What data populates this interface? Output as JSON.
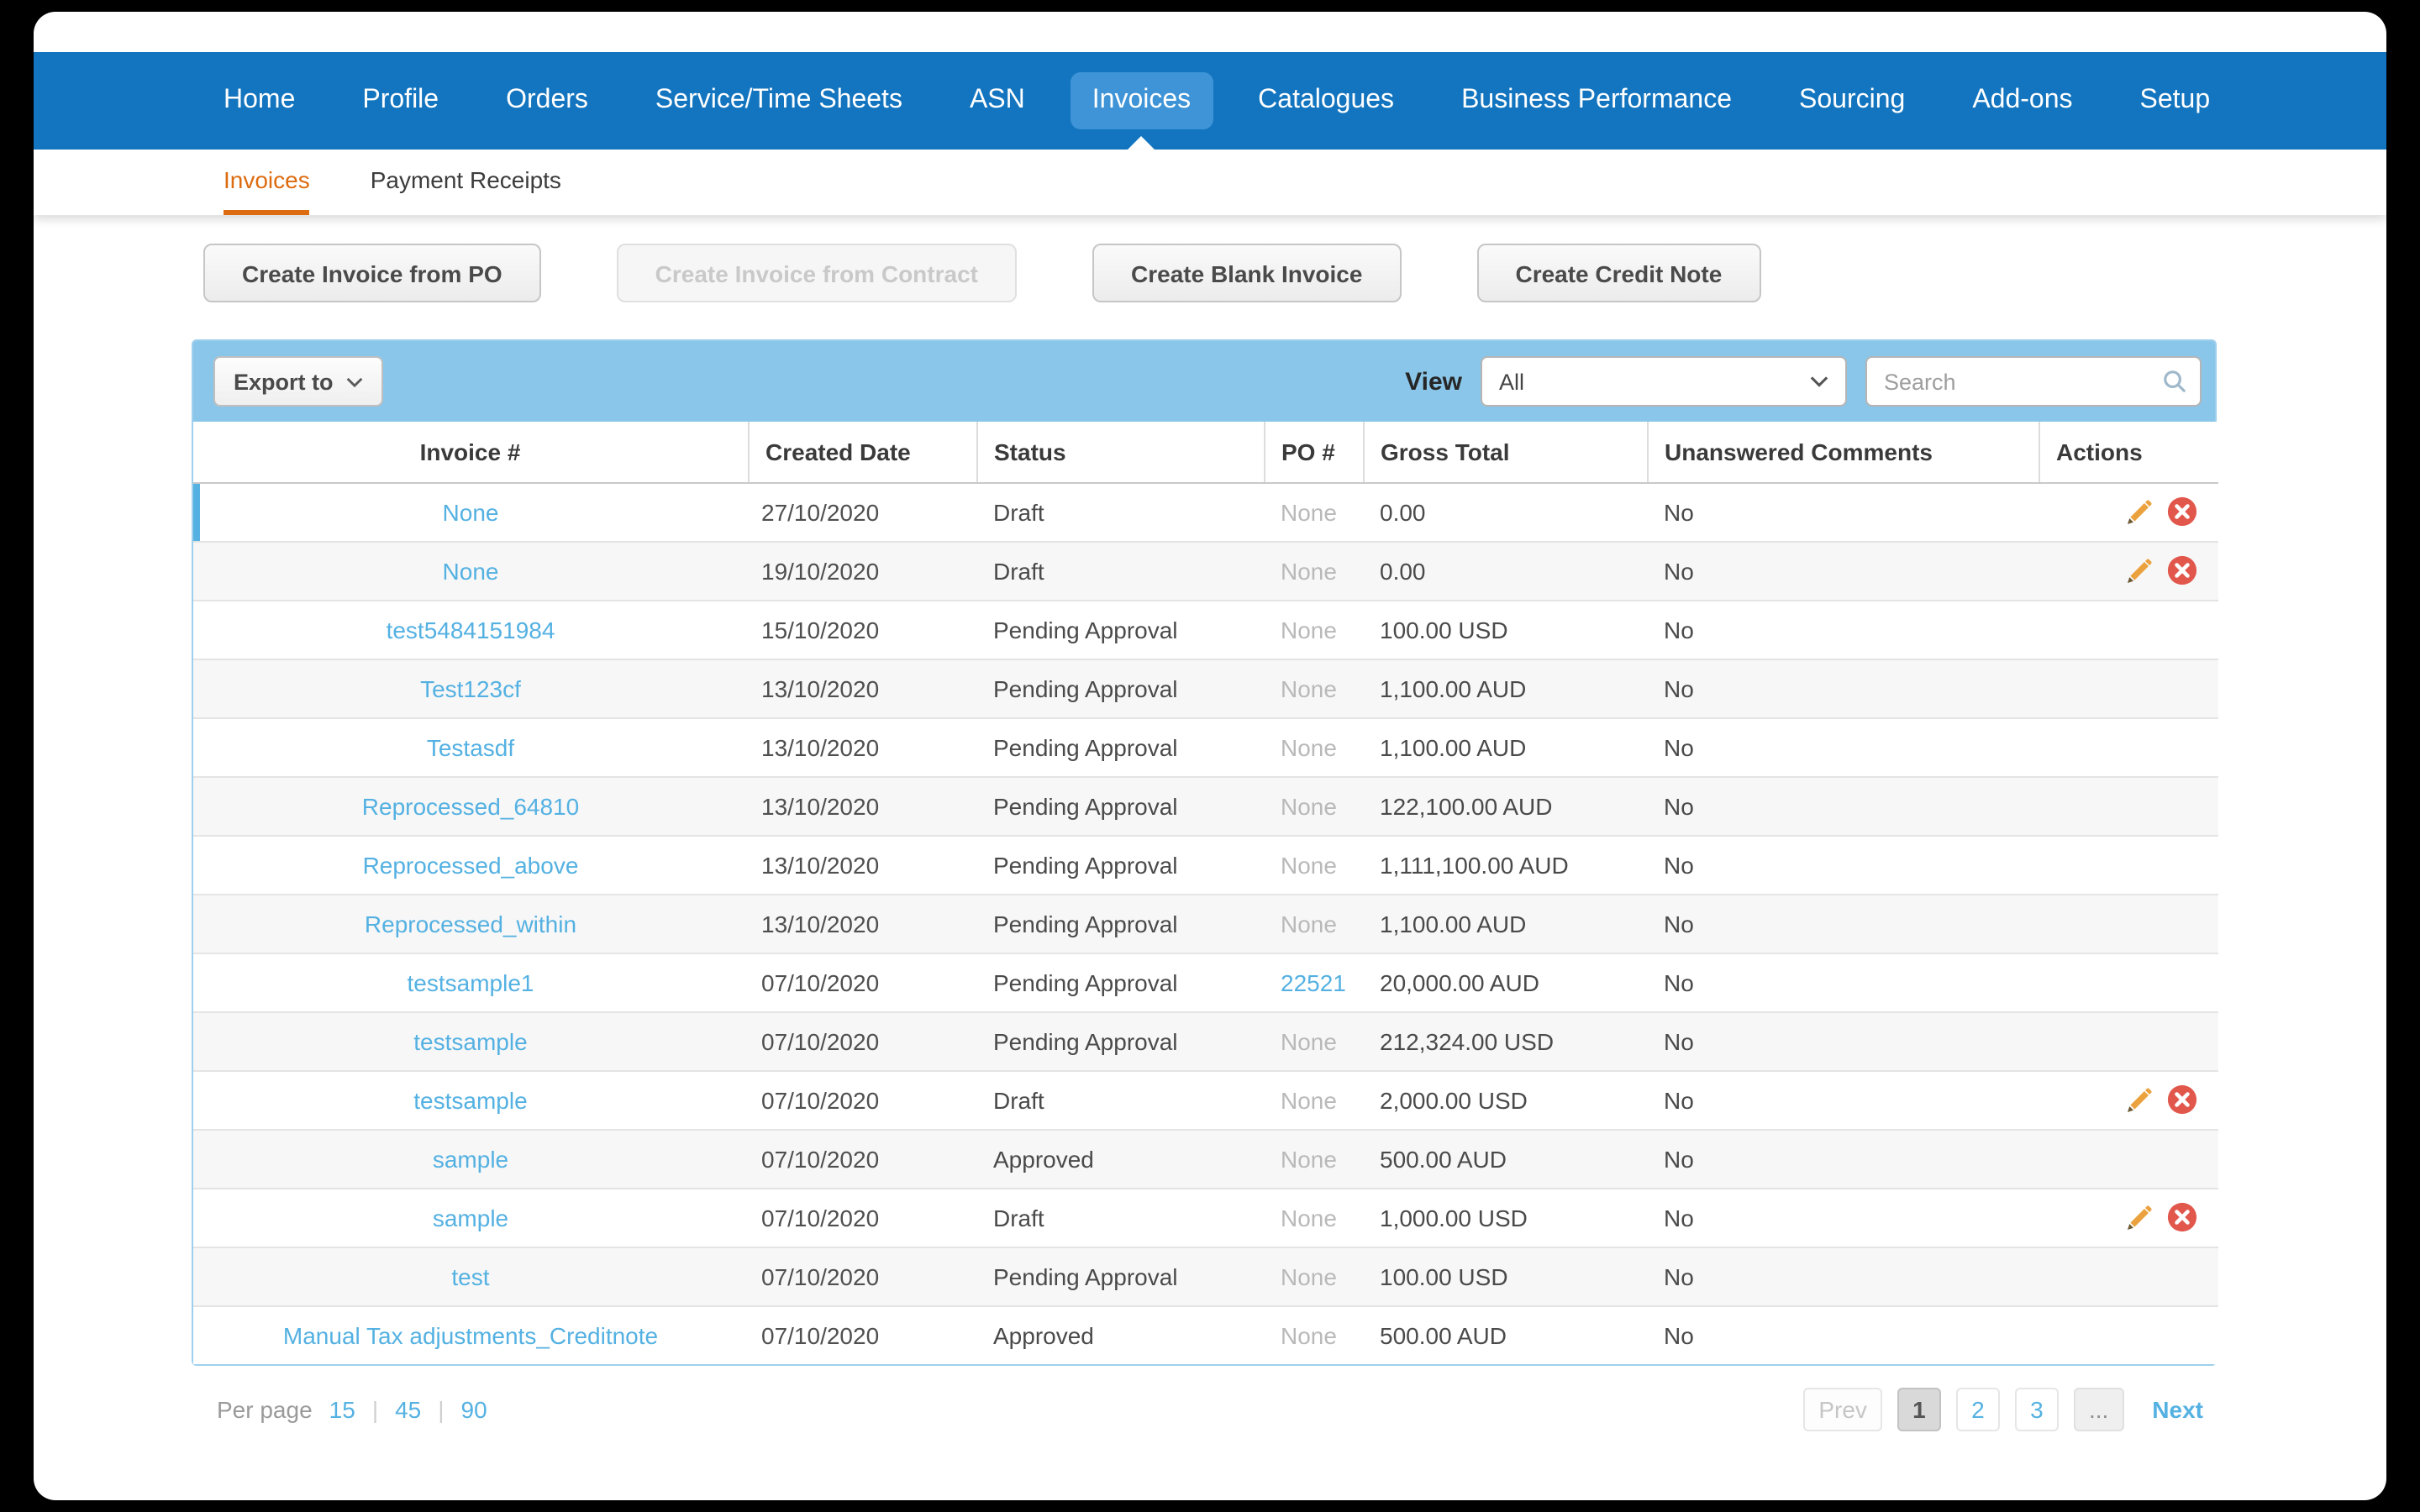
{
  "colors": {
    "nav-blue": "#1375BF",
    "nav-active": "#3E94D6",
    "toolbar-blue": "#8AC6E9",
    "link-blue": "#54B1E2",
    "accent-orange": "#DD6B10",
    "danger-red": "#E2574C",
    "pencil-orange": "#EBA23E"
  },
  "nav": {
    "items": [
      {
        "label": "Home",
        "active": false
      },
      {
        "label": "Profile",
        "active": false
      },
      {
        "label": "Orders",
        "active": false
      },
      {
        "label": "Service/Time Sheets",
        "active": false
      },
      {
        "label": "ASN",
        "active": false
      },
      {
        "label": "Invoices",
        "active": true
      },
      {
        "label": "Catalogues",
        "active": false
      },
      {
        "label": "Business Performance",
        "active": false
      },
      {
        "label": "Sourcing",
        "active": false
      },
      {
        "label": "Add-ons",
        "active": false
      },
      {
        "label": "Setup",
        "active": false
      }
    ]
  },
  "subnav": {
    "items": [
      {
        "label": "Invoices",
        "active": true
      },
      {
        "label": "Payment Receipts",
        "active": false
      }
    ]
  },
  "action_buttons": [
    {
      "label": "Create Invoice from PO",
      "disabled": false
    },
    {
      "label": "Create Invoice from Contract",
      "disabled": true
    },
    {
      "label": "Create Blank Invoice",
      "disabled": false
    },
    {
      "label": "Create Credit Note",
      "disabled": false
    }
  ],
  "toolbar": {
    "export_label": "Export to",
    "view_label": "View",
    "view_value": "All",
    "search_placeholder": "Search"
  },
  "table": {
    "columns": [
      "Invoice #",
      "Created Date",
      "Status",
      "PO #",
      "Gross Total",
      "Unanswered Comments",
      "Actions"
    ],
    "rows": [
      {
        "invoice": "None",
        "created_date": "27/10/2020",
        "status": "Draft",
        "po": "None",
        "po_is_link": false,
        "gross_total": "0.00",
        "unanswered_comments": "No",
        "has_actions": true,
        "selected": true
      },
      {
        "invoice": "None",
        "created_date": "19/10/2020",
        "status": "Draft",
        "po": "None",
        "po_is_link": false,
        "gross_total": "0.00",
        "unanswered_comments": "No",
        "has_actions": true,
        "selected": false
      },
      {
        "invoice": "test5484151984",
        "created_date": "15/10/2020",
        "status": "Pending Approval",
        "po": "None",
        "po_is_link": false,
        "gross_total": "100.00 USD",
        "unanswered_comments": "No",
        "has_actions": false,
        "selected": false
      },
      {
        "invoice": "Test123cf",
        "created_date": "13/10/2020",
        "status": "Pending Approval",
        "po": "None",
        "po_is_link": false,
        "gross_total": "1,100.00 AUD",
        "unanswered_comments": "No",
        "has_actions": false,
        "selected": false
      },
      {
        "invoice": "Testasdf",
        "created_date": "13/10/2020",
        "status": "Pending Approval",
        "po": "None",
        "po_is_link": false,
        "gross_total": "1,100.00 AUD",
        "unanswered_comments": "No",
        "has_actions": false,
        "selected": false
      },
      {
        "invoice": "Reprocessed_64810",
        "created_date": "13/10/2020",
        "status": "Pending Approval",
        "po": "None",
        "po_is_link": false,
        "gross_total": "122,100.00 AUD",
        "unanswered_comments": "No",
        "has_actions": false,
        "selected": false
      },
      {
        "invoice": "Reprocessed_above",
        "created_date": "13/10/2020",
        "status": "Pending Approval",
        "po": "None",
        "po_is_link": false,
        "gross_total": "1,111,100.00 AUD",
        "unanswered_comments": "No",
        "has_actions": false,
        "selected": false
      },
      {
        "invoice": "Reprocessed_within",
        "created_date": "13/10/2020",
        "status": "Pending Approval",
        "po": "None",
        "po_is_link": false,
        "gross_total": "1,100.00 AUD",
        "unanswered_comments": "No",
        "has_actions": false,
        "selected": false
      },
      {
        "invoice": "testsample1",
        "created_date": "07/10/2020",
        "status": "Pending Approval",
        "po": "22521",
        "po_is_link": true,
        "gross_total": "20,000.00 AUD",
        "unanswered_comments": "No",
        "has_actions": false,
        "selected": false
      },
      {
        "invoice": "testsample",
        "created_date": "07/10/2020",
        "status": "Pending Approval",
        "po": "None",
        "po_is_link": false,
        "gross_total": "212,324.00 USD",
        "unanswered_comments": "No",
        "has_actions": false,
        "selected": false
      },
      {
        "invoice": "testsample",
        "created_date": "07/10/2020",
        "status": "Draft",
        "po": "None",
        "po_is_link": false,
        "gross_total": "2,000.00 USD",
        "unanswered_comments": "No",
        "has_actions": true,
        "selected": false
      },
      {
        "invoice": "sample",
        "created_date": "07/10/2020",
        "status": "Approved",
        "po": "None",
        "po_is_link": false,
        "gross_total": "500.00 AUD",
        "unanswered_comments": "No",
        "has_actions": false,
        "selected": false
      },
      {
        "invoice": "sample",
        "created_date": "07/10/2020",
        "status": "Draft",
        "po": "None",
        "po_is_link": false,
        "gross_total": "1,000.00 USD",
        "unanswered_comments": "No",
        "has_actions": true,
        "selected": false
      },
      {
        "invoice": "test",
        "created_date": "07/10/2020",
        "status": "Pending Approval",
        "po": "None",
        "po_is_link": false,
        "gross_total": "100.00 USD",
        "unanswered_comments": "No",
        "has_actions": false,
        "selected": false
      },
      {
        "invoice": "Manual Tax adjustments_Creditnote",
        "created_date": "07/10/2020",
        "status": "Approved",
        "po": "None",
        "po_is_link": false,
        "gross_total": "500.00 AUD",
        "unanswered_comments": "No",
        "has_actions": false,
        "selected": false
      }
    ]
  },
  "footer": {
    "per_page_label": "Per page",
    "per_page_options": [
      "15",
      "45",
      "90"
    ],
    "separator": "|",
    "pagination": {
      "prev_label": "Prev",
      "pages": [
        "1",
        "2",
        "3"
      ],
      "current_page": "1",
      "ellipsis": "...",
      "next_label": "Next"
    }
  },
  "icons": {
    "edit_action": "pencil-icon",
    "delete_action": "delete-icon",
    "search": "search-icon",
    "dropdowns": "chevron-down-icon"
  }
}
